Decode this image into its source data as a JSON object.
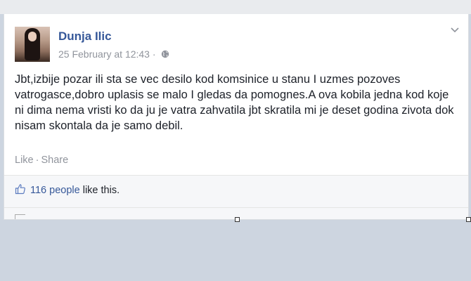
{
  "post": {
    "author": "Dunja Ilic",
    "timestamp": "25 February at 12:43",
    "separator": "·",
    "text": "Jbt,izbije pozar ili sta se vec desilo kod komsinice u stanu I uzmes pozoves vatrogasce,dobro uplasis se malo I gledas da pomognes.A ova kobila jedna kod koje ni dima nema vristi ko da ju je vatra zahvatila jbt skratila mi je deset godina zivota dok nisam skontala da je samo debil.",
    "actions": {
      "like_label": "Like",
      "separator": "·",
      "share_label": "Share"
    },
    "likes": {
      "count_text": "116 people",
      "suffix": "like this."
    },
    "icons": {
      "privacy": "globe-icon",
      "options": "chevron-down-icon",
      "likes": "thumbs-up-icon"
    }
  },
  "colors": {
    "link": "#365899",
    "meta": "#90949c",
    "text": "#1d2129",
    "background": "#cdd5e0"
  }
}
